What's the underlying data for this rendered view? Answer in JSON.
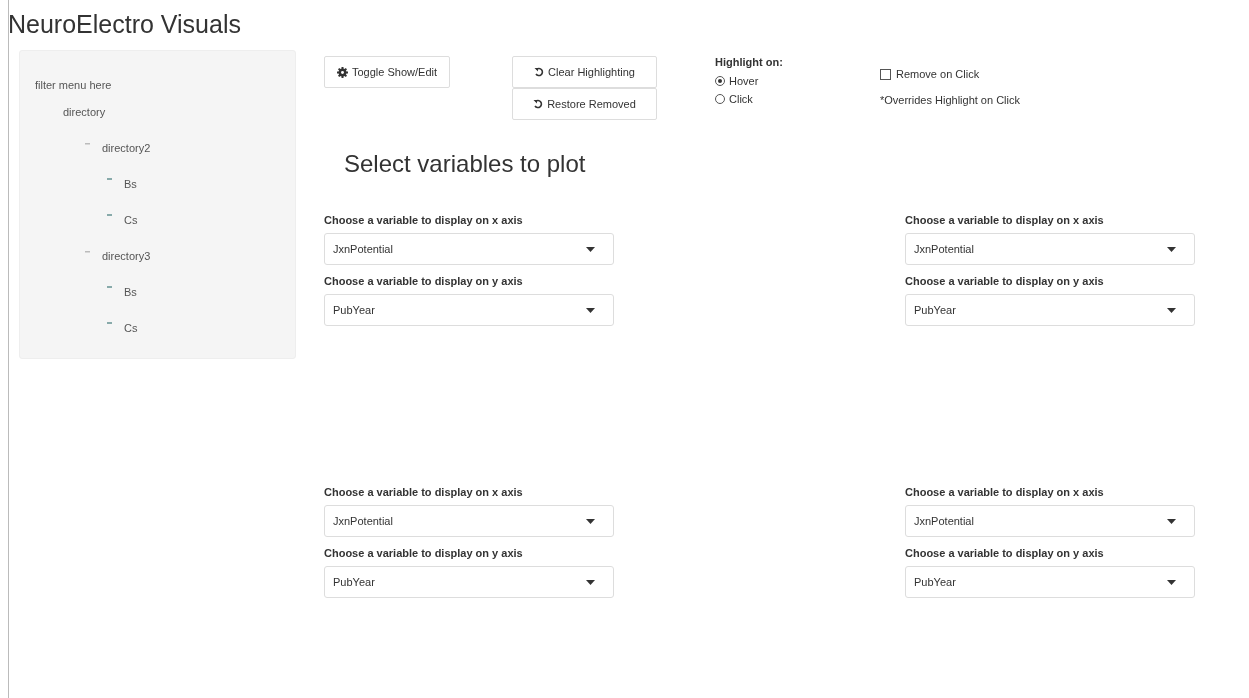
{
  "title": "NeuroElectro Visuals",
  "sidebar": {
    "heading": "filter menu here",
    "tree": [
      {
        "label": "directory",
        "children": [
          {
            "label": "directory2",
            "expanded": true,
            "children": [
              {
                "label": "Bs"
              },
              {
                "label": "Cs"
              }
            ]
          },
          {
            "label": "directory3",
            "expanded": true,
            "children": [
              {
                "label": "Bs"
              },
              {
                "label": "Cs"
              }
            ]
          }
        ]
      }
    ]
  },
  "toolbar": {
    "toggle_button": "Toggle Show/Edit",
    "clear_button": "Clear Highlighting",
    "restore_button": "Restore Removed",
    "highlight": {
      "label": "Highlight on:",
      "options": [
        {
          "label": "Hover",
          "selected": true
        },
        {
          "label": "Click",
          "selected": false
        }
      ]
    },
    "remove_on_click": {
      "label": "Remove on Click",
      "checked": false
    },
    "note": "*Overrides Highlight on Click"
  },
  "heading": "Select variables to plot",
  "plots": [
    {
      "x_label": "Choose a variable to display on x axis",
      "x_value": "JxnPotential",
      "y_label": "Choose a variable to display on y axis",
      "y_value": "PubYear"
    },
    {
      "x_label": "Choose a variable to display on x axis",
      "x_value": "JxnPotential",
      "y_label": "Choose a variable to display on y axis",
      "y_value": "PubYear"
    },
    {
      "x_label": "Choose a variable to display on x axis",
      "x_value": "JxnPotential",
      "y_label": "Choose a variable to display on y axis",
      "y_value": "PubYear"
    },
    {
      "x_label": "Choose a variable to display on x axis",
      "x_value": "JxnPotential",
      "y_label": "Choose a variable to display on y axis",
      "y_value": "PubYear"
    }
  ]
}
